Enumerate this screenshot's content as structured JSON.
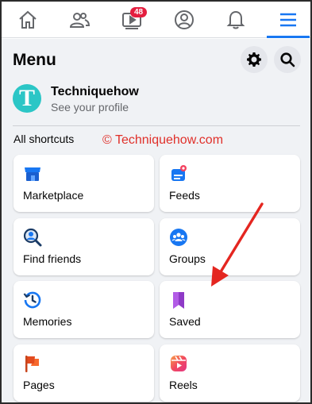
{
  "nav": {
    "items": [
      {
        "name": "home-icon"
      },
      {
        "name": "friends-icon"
      },
      {
        "name": "watch-icon"
      },
      {
        "name": "profile-icon"
      },
      {
        "name": "notifications-icon"
      },
      {
        "name": "menu-icon"
      }
    ],
    "watch_badge": "48",
    "active_color": "#1877f2"
  },
  "header": {
    "title": "Menu",
    "settings_icon": "gear-icon",
    "search_icon": "search-icon"
  },
  "profile": {
    "avatar_letter": "T",
    "name": "Techniquehow",
    "subtitle": "See your profile"
  },
  "shortcuts": {
    "label": "All shortcuts",
    "watermark": "© Techniquehow.com",
    "items": [
      {
        "label": "Marketplace",
        "icon": "marketplace-icon"
      },
      {
        "label": "Feeds",
        "icon": "feeds-icon"
      },
      {
        "label": "Find friends",
        "icon": "find-friends-icon"
      },
      {
        "label": "Groups",
        "icon": "groups-icon"
      },
      {
        "label": "Memories",
        "icon": "memories-icon"
      },
      {
        "label": "Saved",
        "icon": "saved-icon"
      },
      {
        "label": "Pages",
        "icon": "pages-icon"
      },
      {
        "label": "Reels",
        "icon": "reels-icon"
      }
    ]
  }
}
